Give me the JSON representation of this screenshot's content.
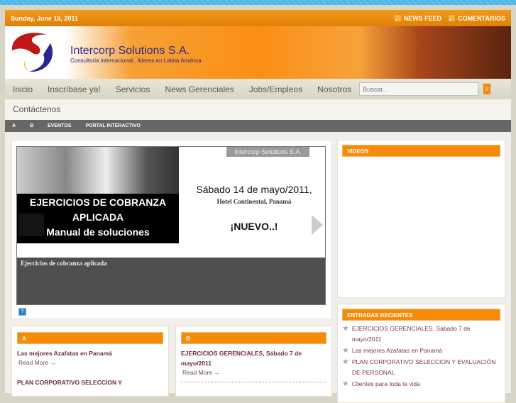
{
  "topbar": {
    "date": "Sunday, June 19, 2011",
    "news_feed": "NEWS FEED",
    "comentarios": "COMENTARIOS"
  },
  "header": {
    "title": "Intercorp Solutions S.A.",
    "subtitle": "Consultoria internacional.. lideres en Latino América"
  },
  "nav": {
    "items": [
      "Inicio",
      "Inscríbase ya!",
      "Servicios",
      "News Gerenciales",
      "Jobs/Empleos",
      "Nosotros"
    ],
    "second_row": "Contáctenos",
    "search_placeholder": "Buscar...",
    "search_button": "Ir"
  },
  "subnav": {
    "items": [
      "A",
      "B",
      "EVENTOS",
      "PORTAL INTERACTIVO"
    ]
  },
  "slider": {
    "tag": "Intercorp Solutions S.A.",
    "line1": "EJERCICIOS DE COBRANZA",
    "line2": "APLICADA",
    "line3": "Manual de soluciones",
    "date": "Sábado 14 de mayo/2011,",
    "hotel": "Hotel Continental, Panamá",
    "nuevo": "¡NUEVO..!",
    "caption": "Ejercicios de cobranza aplicada",
    "help": "?"
  },
  "videos": {
    "title": "VIDEOS"
  },
  "entradas": {
    "title": "ENTRADAS RECIENTES",
    "items": [
      "EJERCICIOS GERENCIALES, Sábado 7 de mayo/2011",
      "Las mejores Azafatas en Panamá",
      "PLAN CORPORATIVO SELECCION Y EVALUACIÓN DE PERSONAL",
      "Clientes para toda la vida"
    ]
  },
  "boxA": {
    "title": "A",
    "post1": "Las mejores Azafatas en Panamá",
    "read_more": "Read More →",
    "post2": "PLAN CORPORATIVO SELECCION Y"
  },
  "boxB": {
    "title": "B",
    "post1": "EJERCICIOS GERENCIALES, Sábado 7 de mayo/2011",
    "read_more": "Read More →"
  }
}
